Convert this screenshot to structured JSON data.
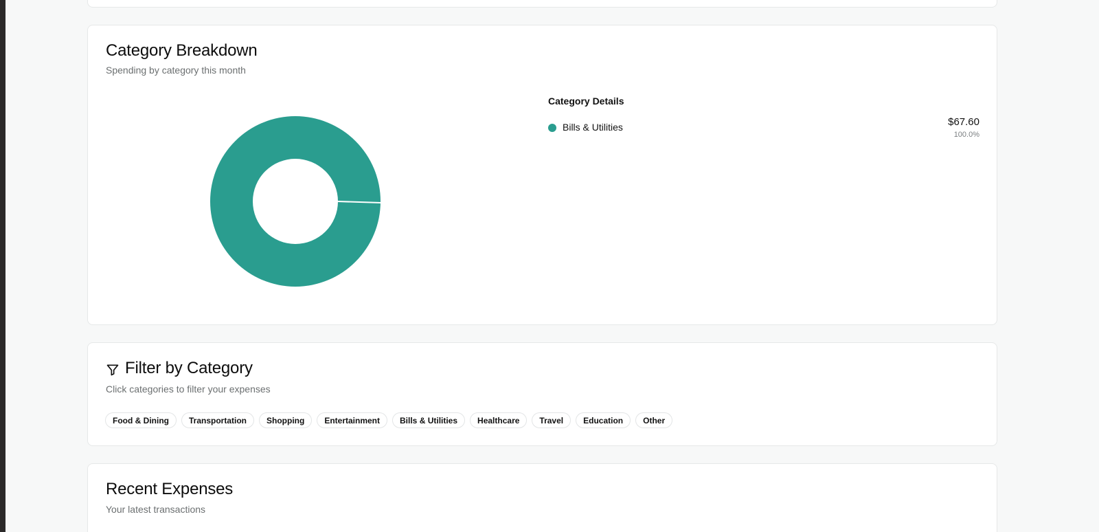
{
  "breakdown": {
    "title": "Category Breakdown",
    "subtitle": "Spending by category this month",
    "details_heading": "Category Details",
    "items": [
      {
        "label": "Bills & Utilities",
        "amount": "$67.60",
        "percent": "100.0%",
        "color": "#2a9d8f"
      }
    ]
  },
  "chart_data": {
    "type": "pie",
    "donut": true,
    "categories": [
      "Bills & Utilities"
    ],
    "values": [
      67.6
    ],
    "colors": [
      "#2a9d8f"
    ]
  },
  "filter": {
    "title": "Filter by Category",
    "subtitle": "Click categories to filter your expenses",
    "icon": "filter-icon",
    "chips": [
      "Food & Dining",
      "Transportation",
      "Shopping",
      "Entertainment",
      "Bills & Utilities",
      "Healthcare",
      "Travel",
      "Education",
      "Other"
    ]
  },
  "recent": {
    "title": "Recent Expenses",
    "subtitle": "Your latest transactions"
  },
  "colors": {
    "accent": "#2a9d8f",
    "page_bg": "#f7f8f8",
    "card_bg": "#ffffff",
    "border": "#e6e8e8",
    "muted_text": "#6b6f70"
  }
}
